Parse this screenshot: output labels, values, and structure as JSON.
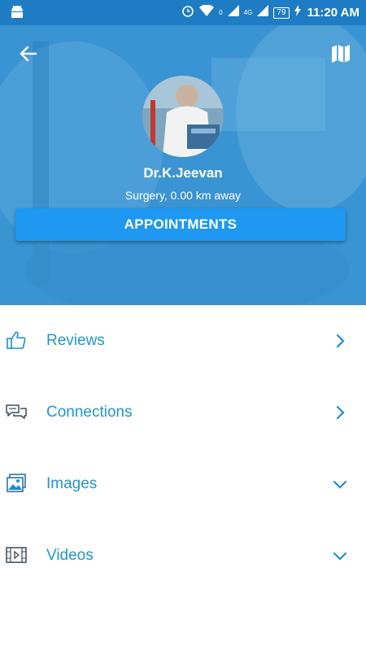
{
  "status_bar": {
    "time": "11:20 AM",
    "battery": "79",
    "net_label_1": "0",
    "net_label_2": "4G"
  },
  "header": {
    "back_icon": "arrow-left-icon",
    "map_icon": "map-icon"
  },
  "doctor": {
    "name": "Dr.K.Jeevan",
    "subtitle": "Surgery, 0.00 km away"
  },
  "appointments_button": "APPOINTMENTS",
  "sections": [
    {
      "label": "Reviews",
      "icon": "thumbs-up-icon",
      "chevron": "chevron-right-icon"
    },
    {
      "label": "Connections",
      "icon": "chat-bubbles-icon",
      "chevron": "chevron-right-icon"
    },
    {
      "label": "Images",
      "icon": "images-icon",
      "chevron": "chevron-down-icon"
    },
    {
      "label": "Videos",
      "icon": "video-icon",
      "chevron": "chevron-down-icon"
    }
  ],
  "colors": {
    "status_bar": "#1e7cc4",
    "header_overlay": "#3f9ad6",
    "button": "#1e98f0",
    "accent_text": "#2196c8"
  }
}
